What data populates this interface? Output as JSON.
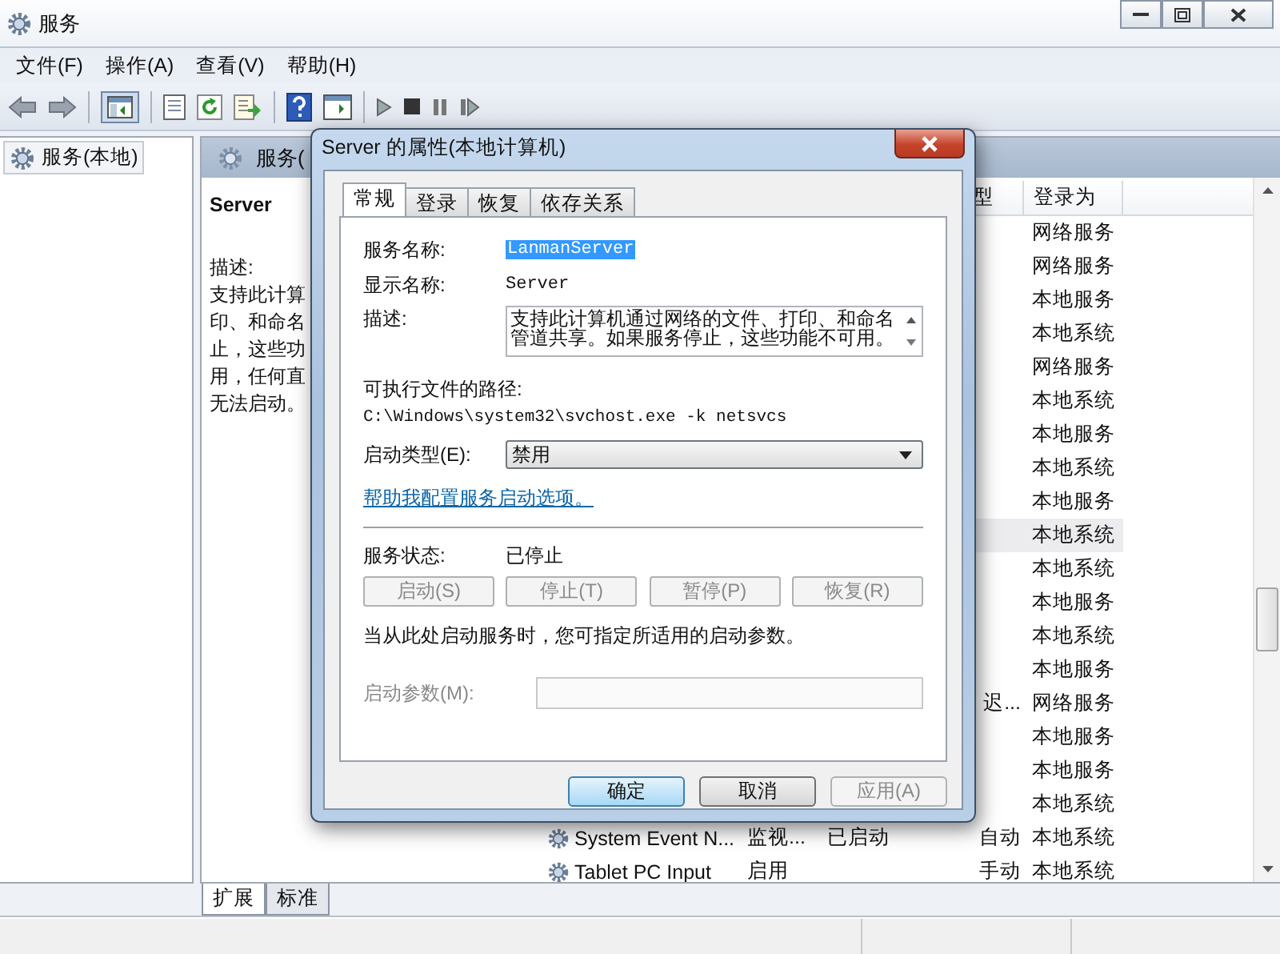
{
  "window": {
    "title": "服务"
  },
  "menu": [
    "文件(F)",
    "操作(A)",
    "查看(V)",
    "帮助(H)"
  ],
  "tree": {
    "label": "服务(本地)"
  },
  "pane": {
    "header": "服务(",
    "title": "Server",
    "description_label": "描述:",
    "description_lines": [
      "支持此计算",
      "印、和命名",
      "止，这些功",
      "用，任何直",
      "无法启动。"
    ]
  },
  "list": {
    "columns": [
      "型",
      "登录为"
    ],
    "rows": [
      {
        "logon": "网络服务",
        "selected": false
      },
      {
        "logon": "网络服务",
        "selected": false
      },
      {
        "logon": "本地服务",
        "selected": false
      },
      {
        "logon": "本地系统",
        "selected": false
      },
      {
        "logon": "网络服务",
        "selected": false
      },
      {
        "logon": "本地系统",
        "selected": false
      },
      {
        "logon": "本地服务",
        "selected": false
      },
      {
        "logon": "本地系统",
        "selected": false
      },
      {
        "logon": "本地服务",
        "selected": false
      },
      {
        "logon": "本地系统",
        "selected": true
      },
      {
        "logon": "本地系统",
        "selected": false
      },
      {
        "logon": "本地服务",
        "selected": false
      },
      {
        "logon": "本地系统",
        "selected": false
      },
      {
        "logon": "本地服务",
        "selected": false
      },
      {
        "startup": "迟...",
        "logon": "网络服务",
        "selected": false
      },
      {
        "logon": "本地服务",
        "selected": false
      },
      {
        "logon": "本地服务",
        "selected": false
      },
      {
        "logon": "本地系统",
        "selected": false
      },
      {
        "name": "System Event N...",
        "description": "监视...",
        "status": "已启动",
        "startup": "自动",
        "logon": "本地系统",
        "selected": false
      },
      {
        "name": "Tablet PC Input",
        "description": "启用",
        "startup": "手动",
        "logon": "本地系统",
        "selected": false
      }
    ]
  },
  "view_tabs": [
    {
      "label": "扩展",
      "selected": true
    },
    {
      "label": "标准",
      "selected": false
    }
  ],
  "dialog": {
    "title": "Server 的属性(本地计算机)",
    "tabs": [
      {
        "label": "常规",
        "selected": true
      },
      {
        "label": "登录",
        "selected": false
      },
      {
        "label": "恢复",
        "selected": false
      },
      {
        "label": "依存关系",
        "selected": false
      }
    ],
    "service_name_label": "服务名称:",
    "service_name": {
      "value": "LanmanServer",
      "selected": true
    },
    "display_name_label": "显示名称:",
    "display_name": "Server",
    "description_label": "描述:",
    "description": "支持此计算机通过网络的文件、打印、和命名管道共享。如果服务停止，这些功能不可用。",
    "path_label": "可执行文件的路径:",
    "path": "C:\\Windows\\system32\\svchost.exe -k netsvcs",
    "startup_type_label": "启动类型(E):",
    "startup_type": "禁用",
    "help_link": "帮助我配置服务启动选项。",
    "status_label": "服务状态:",
    "status": "已停止",
    "control_buttons": [
      {
        "label": "启动(S)",
        "disabled": true
      },
      {
        "label": "停止(T)",
        "disabled": true
      },
      {
        "label": "暂停(P)",
        "disabled": true
      },
      {
        "label": "恢复(R)",
        "disabled": true
      }
    ],
    "hint": "当从此处启动服务时，您可指定所适用的启动参数。",
    "params": {
      "label": "启动参数(M):",
      "disabled": true
    },
    "buttons": [
      {
        "label": "确定",
        "kind": "default"
      },
      {
        "label": "取消",
        "kind": "normal"
      },
      {
        "label": "应用(A)",
        "kind": "disabled"
      }
    ]
  }
}
